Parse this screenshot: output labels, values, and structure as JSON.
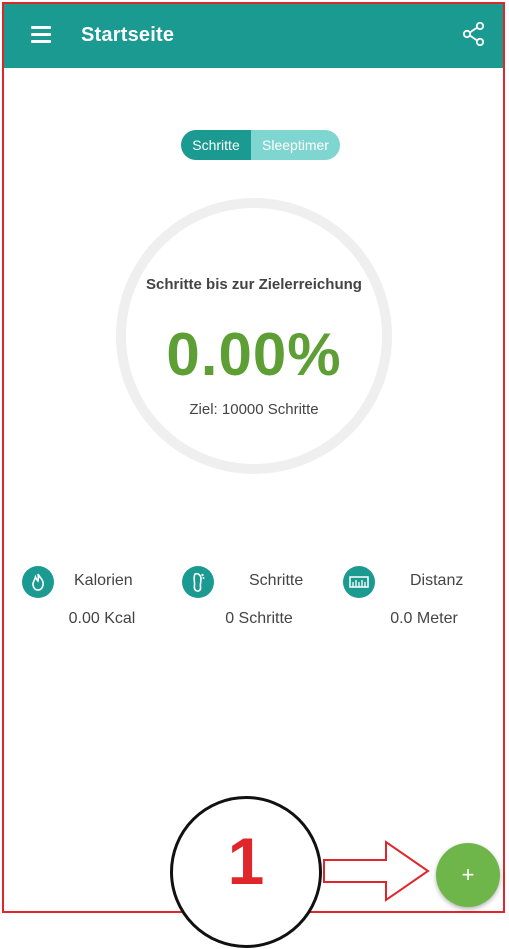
{
  "appbar": {
    "title": "Startseite",
    "background": "#1a9a91",
    "menu_icon": "hamburger-menu-icon",
    "share_icon": "share-icon"
  },
  "toggle": {
    "active": "Schritte",
    "inactive": "Sleeptimer"
  },
  "progress": {
    "label": "Schritte bis zur Zielerreichung",
    "percent": "0.00%",
    "goal": "Ziel: 10000 Schritte",
    "fill_fraction": 0
  },
  "stats": [
    {
      "icon": "flame-icon",
      "label": "Kalorien",
      "value": "0.00 Kcal"
    },
    {
      "icon": "footprint-icon",
      "label": "Schritte",
      "value": "0 Schritte"
    },
    {
      "icon": "ruler-icon",
      "label": "Distanz",
      "value": "0.0 Meter"
    }
  ],
  "fab": {
    "label": "+",
    "color": "#6fb64a"
  },
  "annotation": {
    "number": "1",
    "color": "#e0262b"
  }
}
